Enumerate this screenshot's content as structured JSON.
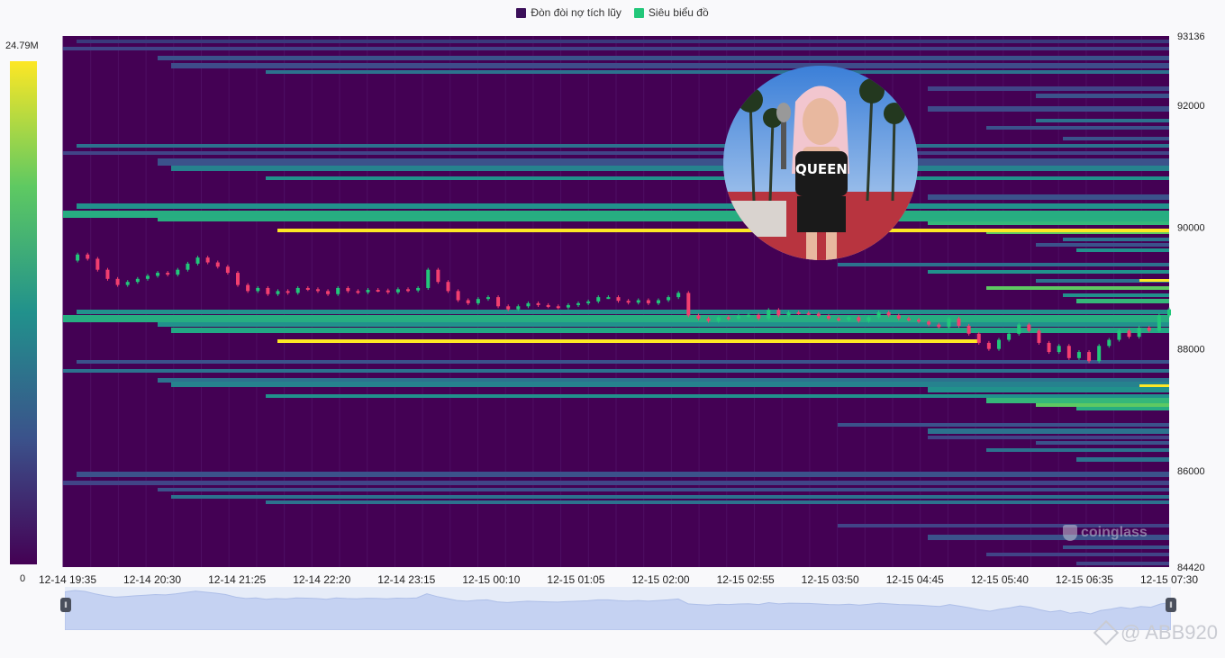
{
  "legend": [
    {
      "label": "Đòn đòi nợ tích lũy",
      "color": "#3b0f59"
    },
    {
      "label": "Siêu biểu đồ",
      "color": "#22c77a"
    }
  ],
  "colorbar": {
    "max_label": "24.79M",
    "min_label": "0"
  },
  "avatar": {
    "text": "QUEEN"
  },
  "brand": {
    "name": "coinglass"
  },
  "watermark": {
    "text": "@ ABB920"
  },
  "chart_data": {
    "type": "heatmap",
    "title": "",
    "y_ticks": [
      "93136",
      "92000",
      "90000",
      "88000",
      "86000",
      "84420"
    ],
    "ylim": [
      84420,
      93136
    ],
    "x_ticks": [
      "12-14 19:35",
      "12-14 20:30",
      "12-14 21:25",
      "12-14 22:20",
      "12-14 23:15",
      "12-15 00:10",
      "12-15 01:05",
      "12-15 02:00",
      "12-15 02:55",
      "12-15 03:50",
      "12-15 04:45",
      "12-15 05:40",
      "12-15 06:35",
      "12-15 07:30"
    ],
    "colorscale": [
      "#440154",
      "#3b528b",
      "#21918c",
      "#5ec962",
      "#fde725"
    ],
    "value_range_label": [
      "0",
      "24.79M"
    ],
    "price_series": [
      89450,
      89550,
      89480,
      89300,
      89150,
      89050,
      89100,
      89150,
      89200,
      89250,
      89220,
      89300,
      89400,
      89500,
      89420,
      89350,
      89250,
      89050,
      88950,
      89000,
      88900,
      88950,
      88920,
      89000,
      88980,
      88950,
      88900,
      89000,
      88950,
      88930,
      88970,
      88960,
      88930,
      88980,
      88960,
      89000,
      89300,
      89100,
      88950,
      88800,
      88750,
      88820,
      88850,
      88700,
      88650,
      88700,
      88750,
      88720,
      88700,
      88680,
      88720,
      88750,
      88780,
      88850,
      88850,
      88790,
      88760,
      88800,
      88750,
      88800,
      88850,
      88920,
      88550,
      88500,
      88460,
      88520,
      88500,
      88540,
      88560,
      88500,
      88640,
      88550,
      88600,
      88590,
      88580,
      88540,
      88500,
      88480,
      88520,
      88460,
      88520,
      88600,
      88550,
      88500,
      88480,
      88450,
      88400,
      88360,
      88500,
      88380,
      88250,
      88100,
      88000,
      88150,
      88250,
      88400,
      88300,
      88100,
      87950,
      88050,
      87850,
      87950,
      87800,
      88050,
      88150,
      88300,
      88200,
      88350,
      88300,
      88550,
      88650
    ]
  }
}
